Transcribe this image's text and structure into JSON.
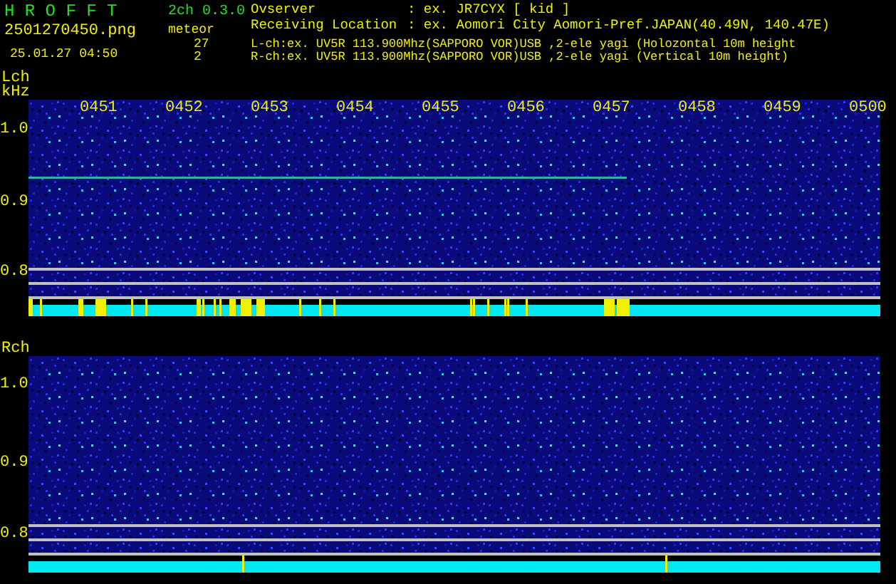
{
  "header": {
    "app_name": "H R O F F T",
    "version": "2ch 0.3.0",
    "file_name": "2501270450.png",
    "timestamp": "25.01.27 04:50",
    "mode": "meteor",
    "counts": [
      "27",
      "2"
    ],
    "info": [
      {
        "label": "Ovserver",
        "value": ": ex. JR7CYX [ kid ]"
      },
      {
        "label": "Receiving Location",
        "value": ": ex. Aomori City Aomori-Pref.JAPAN(40.49N, 140.47E)"
      }
    ],
    "channels": [
      "L-ch:ex. UV5R 113.900Mhz(SAPPORO VOR)USB ,2-ele yagi (Holozontal 10m height",
      "R-ch:ex. UV5R 113.900Mhz(SAPPORO VOR)USB ,2-ele yagi (Vertical 10m height)"
    ]
  },
  "panels": [
    {
      "channel_label": "Lch",
      "unit": "kHz",
      "time_labels": [
        "0451",
        "0452",
        "0453",
        "0454",
        "0455",
        "0456",
        "0457",
        "0458",
        "0459",
        "0500"
      ],
      "y_labels": [
        "1.0",
        "0.9",
        "0.8"
      ]
    },
    {
      "channel_label": "Rch",
      "y_labels": [
        "1.0",
        "0.9",
        "0.8"
      ]
    }
  ]
}
